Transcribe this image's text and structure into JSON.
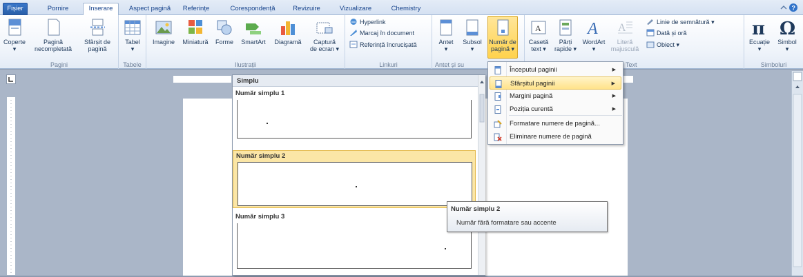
{
  "tabs": [
    "Fișier",
    "Pornire",
    "Inserare",
    "Aspect pagină",
    "Referințe",
    "Corespondență",
    "Revizuire",
    "Vizualizare",
    "Chemistry"
  ],
  "ribbon": {
    "pagini": {
      "label": "Pagini",
      "coperte": "Coperte",
      "pagina_necompletata_1": "Pagină",
      "pagina_necompletata_2": "necompletată",
      "sfarsit_1": "Sfârșit de",
      "sfarsit_2": "pagină"
    },
    "tabele": {
      "label": "Tabele",
      "tabel": "Tabel"
    },
    "ilustratii": {
      "label": "Ilustrații",
      "imagine": "Imagine",
      "miniatura": "Miniatură",
      "forme": "Forme",
      "smartart": "SmartArt",
      "diagrama": "Diagramă",
      "captura_1": "Captură",
      "captura_2": "de ecran"
    },
    "linkuri": {
      "label": "Linkuri",
      "hyperlink": "Hyperlink",
      "marcaj": "Marcaj în document",
      "referinta": "Referință încrucișată"
    },
    "antet": {
      "label": "Antet și su",
      "antet": "Antet",
      "subsol": "Subsol",
      "numar_1": "Număr de",
      "numar_2": "pagină"
    },
    "text": {
      "label": "Text",
      "caseta_1": "Casetă",
      "caseta_2": "text",
      "parti_1": "Părți",
      "parti_2": "rapide",
      "wordart": "WordArt",
      "litera_1": "Literă",
      "litera_2": "majusculă",
      "linie_semnatura": "Linie de semnătură",
      "data_ora": "Dată și oră",
      "obiect": "Obiect"
    },
    "simboluri": {
      "label": "Simboluri",
      "ecuatie": "Ecuație",
      "simbol": "Simbol"
    }
  },
  "menu": {
    "items": [
      "Începutul paginii",
      "Sfârșitul paginii",
      "Margini pagină",
      "Poziția curentă",
      "Formatare numere de pagină...",
      "Eliminare numere de pagină"
    ]
  },
  "gallery": {
    "header": "Simplu",
    "items": [
      "Număr simplu 1",
      "Număr simplu 2",
      "Număr simplu 3"
    ]
  },
  "tooltip": {
    "title": "Număr simplu 2",
    "description": "Număr fără formatare sau accente"
  },
  "colors": {
    "accent": "#2a5fa8",
    "highlight": "#ffd24d",
    "selected_item": "#fbe6a6"
  }
}
